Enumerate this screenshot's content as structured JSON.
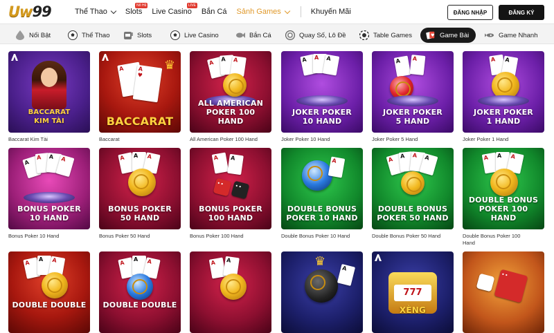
{
  "brand": {
    "logo_main": "Uw",
    "logo_num": "99"
  },
  "nav": {
    "items": [
      {
        "label": "Thể Thao",
        "has_chevron": true
      },
      {
        "label": "Slots",
        "badge": "Nổ Hũ"
      },
      {
        "label": "Live Casino",
        "badge": "LIVE"
      },
      {
        "label": "Bắn Cá"
      },
      {
        "label": "Sảnh Games",
        "has_chevron": true,
        "active": true
      },
      {
        "label": "Khuyến Mãi"
      }
    ],
    "login_label": "ĐĂNG NHẬP",
    "register_label": "ĐĂNG KÝ",
    "active_color": "#e0992a"
  },
  "categories": [
    {
      "label": "Nổi Bật",
      "icon": "drop-icon"
    },
    {
      "label": "Thể Thao",
      "icon": "soccer-ball-icon"
    },
    {
      "label": "Slots",
      "icon": "slot-machine-icon"
    },
    {
      "label": "Live Casino",
      "icon": "soccer-ball-icon"
    },
    {
      "label": "Bắn Cá",
      "icon": "fish-icon"
    },
    {
      "label": "Quay Số, Lô Đề",
      "icon": "lottery-ball-icon"
    },
    {
      "label": "Table Games",
      "icon": "chip-icon"
    },
    {
      "label": "Game Bài",
      "icon": "cards-icon",
      "active": true
    },
    {
      "label": "Game Nhanh",
      "icon": "rocket-icon"
    }
  ],
  "games": [
    {
      "title": "BACCARAT\nKIM TÀI",
      "name": "Baccarat Kim Tài",
      "theme": "purple"
    },
    {
      "title": "BACCARAT",
      "name": "Baccarat",
      "theme": "red"
    },
    {
      "title": "ALL AMERICAN\nPOKER 100 HAND",
      "name": "All American Poker 100 Hand",
      "theme": "crimson"
    },
    {
      "title": "JOKER POKER\n10 HAND",
      "name": "Joker Poker 10 Hand",
      "theme": "violet"
    },
    {
      "title": "JOKER POKER\n5 HAND",
      "name": "Joker Poker 5 Hand",
      "theme": "violet"
    },
    {
      "title": "JOKER POKER\n1 HAND",
      "name": "Joker Poker 1 Hand",
      "theme": "violet"
    },
    {
      "title": "BONUS POKER\n10 HAND",
      "name": "Bonus Poker 10 Hand",
      "theme": "magenta"
    },
    {
      "title": "BONUS POKER\n50 HAND",
      "name": "Bonus Poker 50 Hand",
      "theme": "crimson"
    },
    {
      "title": "BONUS POKER\n100 HAND",
      "name": "Bonus Poker 100 Hand",
      "theme": "crimson"
    },
    {
      "title": "DOUBLE BONUS\nPOKER 10 HAND",
      "name": "Double Bonus Poker 10 Hand",
      "theme": "green"
    },
    {
      "title": "DOUBLE BONUS\nPOKER 50 HAND",
      "name": "Double Bonus Poker 50 Hand",
      "theme": "green"
    },
    {
      "title": "DOUBLE BONUS\nPOKER 100 HAND",
      "name": "Double Bonus Poker 100\nHand",
      "theme": "green"
    },
    {
      "title": "DOUBLE DOUBLE",
      "name": "",
      "theme": "red"
    },
    {
      "title": "DOUBLE DOUBLE",
      "name": "",
      "theme": "crimson"
    },
    {
      "title": "",
      "name": "",
      "theme": "crimson"
    },
    {
      "title": "",
      "name": "",
      "theme": "navy"
    },
    {
      "title": "XÈNG",
      "name": "",
      "theme": "navy"
    },
    {
      "title": "",
      "name": "",
      "theme": "orange"
    }
  ]
}
